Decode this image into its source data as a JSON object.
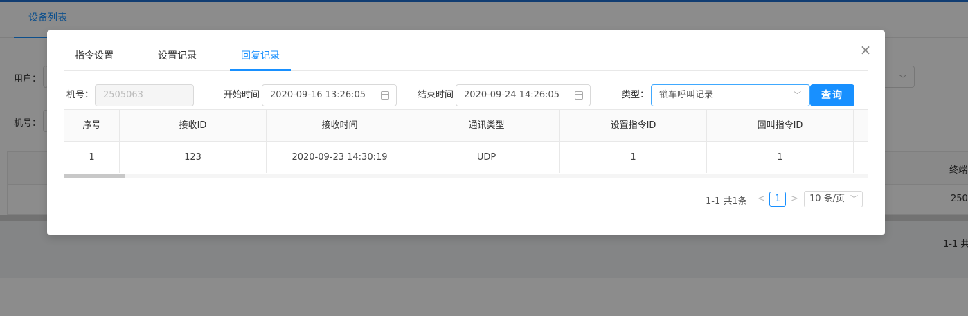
{
  "background": {
    "tab_label": "设备列表",
    "filter_user_label": "用户：",
    "filter_machine_label": "机号：",
    "table_header_clipped": "终端",
    "table_row_clipped": "250",
    "pagination_clipped": "1-1 共"
  },
  "modal": {
    "close_glyph": "×",
    "tabs": [
      {
        "label": "指令设置",
        "active": false
      },
      {
        "label": "设置记录",
        "active": false
      },
      {
        "label": "回复记录",
        "active": true
      }
    ],
    "filters": {
      "machine_label": "机号：",
      "machine_value": "2505063",
      "start_label": "开始时间",
      "start_value": "2020-09-16 13:26:05",
      "end_label": "结束时间",
      "end_value": "2020-09-24 14:26:05",
      "type_label": "类型：",
      "type_value": "锁车呼叫记录",
      "query_button": "查询"
    },
    "table": {
      "columns": [
        "序号",
        "接收ID",
        "接收时间",
        "通讯类型",
        "设置指令ID",
        "回叫指令ID"
      ],
      "rows": [
        [
          "1",
          "123",
          "2020-09-23 14:30:19",
          "UDP",
          "1",
          "1"
        ]
      ]
    },
    "pagination": {
      "total_text": "1-1 共1条",
      "prev_glyph": "<",
      "current_page": "1",
      "next_glyph": ">",
      "page_size": "10 条/页"
    }
  },
  "icons": {
    "calendar": "calendar-icon",
    "chevron": "chevron-down-icon",
    "close": "close-icon"
  },
  "colors": {
    "accent": "#1890ff",
    "mask": "rgba(0,0,0,0.45)"
  }
}
